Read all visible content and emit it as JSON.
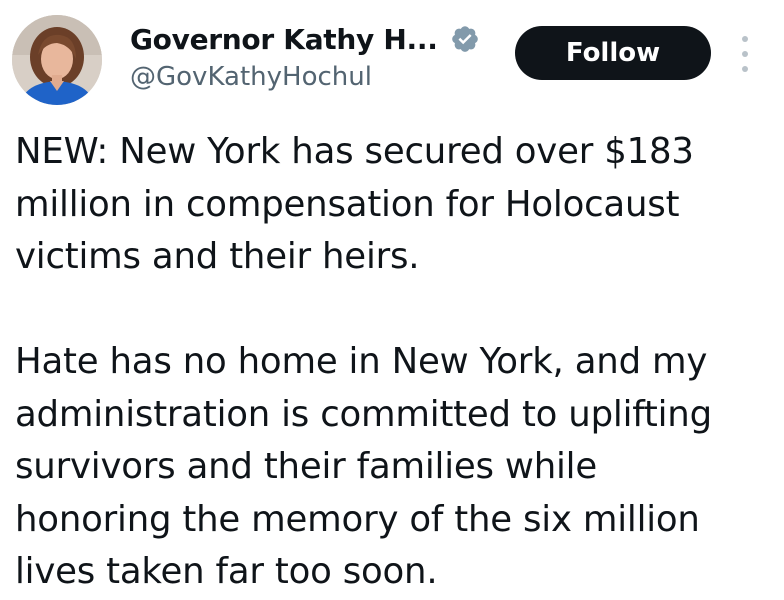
{
  "author": {
    "display_name": "Governor Kathy H...",
    "handle": "@GovKathyHochul",
    "verified_icon": "verified-badge-icon",
    "avatar_icon": "avatar"
  },
  "actions": {
    "follow_label": "Follow",
    "more_icon": "more-vertical-icon"
  },
  "tweet": {
    "paragraph1": [
      "NEW: New York has secured over $183",
      "million in compensation for Holocaust",
      "victims and their heirs."
    ],
    "paragraph2": [
      "Hate has no home in New York, and my",
      "administration is committed to uplifting",
      "survivors and their families while",
      "honoring the memory of the six million",
      "lives taken far too soon."
    ]
  },
  "colors": {
    "text": "#0f1419",
    "secondary_text": "#536471",
    "follow_bg": "#0f1419",
    "follow_text": "#ffffff",
    "verified_badge": "#829aab"
  }
}
